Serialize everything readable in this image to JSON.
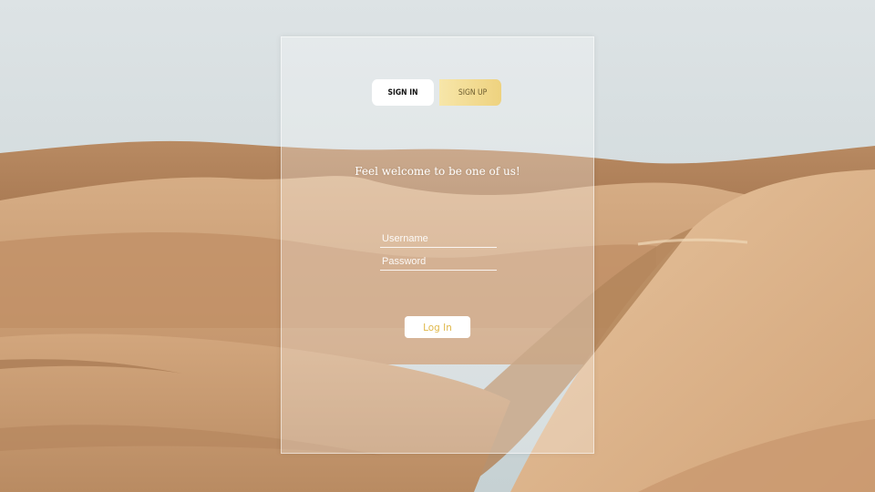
{
  "tabs": {
    "signin_label": "SIGN IN",
    "signup_label": "SIGN UP",
    "active": "signin"
  },
  "welcome_text": "Feel welcome to be one of us!",
  "form": {
    "username_placeholder": "Username",
    "username_value": "",
    "password_placeholder": "Password",
    "password_value": "",
    "login_label": "Log In"
  },
  "colors": {
    "accent_gold": "#e0b84a",
    "signup_gradient_start": "#f7e6a9",
    "signup_gradient_end": "#eed27f",
    "sky": "#cfd8da",
    "sand_light": "#d9b48c",
    "sand_dark": "#a8764f"
  }
}
